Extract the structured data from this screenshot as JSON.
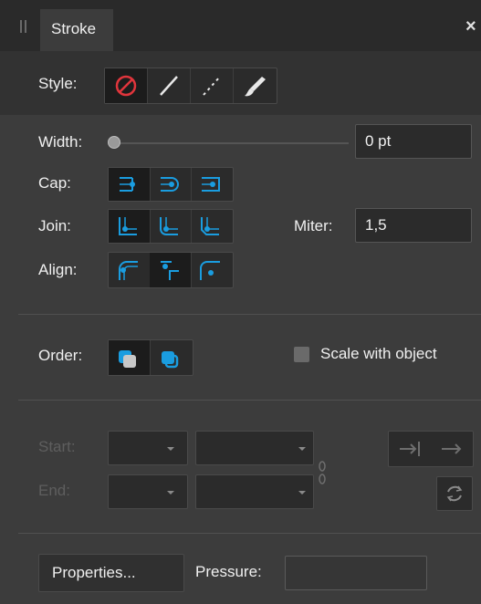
{
  "panel": {
    "tab_label": "Stroke",
    "close_glyph": "×"
  },
  "style": {
    "label": "Style:",
    "options": [
      "none",
      "solid-line",
      "dashed-line",
      "brush"
    ],
    "selected": "none"
  },
  "width": {
    "label": "Width:",
    "value": "0 pt",
    "slider_fraction": 0
  },
  "cap": {
    "label": "Cap:",
    "options": [
      "butt-cap",
      "round-cap",
      "square-cap"
    ],
    "selected": "butt-cap"
  },
  "join": {
    "label": "Join:",
    "options": [
      "miter-join",
      "round-join",
      "bevel-join"
    ],
    "selected": "miter-join"
  },
  "miter": {
    "label": "Miter:",
    "value": "1,5"
  },
  "align": {
    "label": "Align:",
    "options": [
      "align-inside",
      "align-center",
      "align-outside"
    ],
    "selected": "align-center"
  },
  "order": {
    "label": "Order:",
    "options": [
      "stroke-behind-fill",
      "stroke-in-front-of-fill"
    ],
    "selected": "stroke-behind-fill"
  },
  "scale_with_object": {
    "label": "Scale with object",
    "checked": false
  },
  "arrowheads": {
    "start_label": "Start:",
    "end_label": "End:",
    "enabled": false
  },
  "footer": {
    "properties_label": "Properties...",
    "pressure_label": "Pressure:"
  },
  "colors": {
    "accent": "#1a9de0",
    "panel_bg": "#3c3c3c",
    "none_red": "#e0353c"
  }
}
